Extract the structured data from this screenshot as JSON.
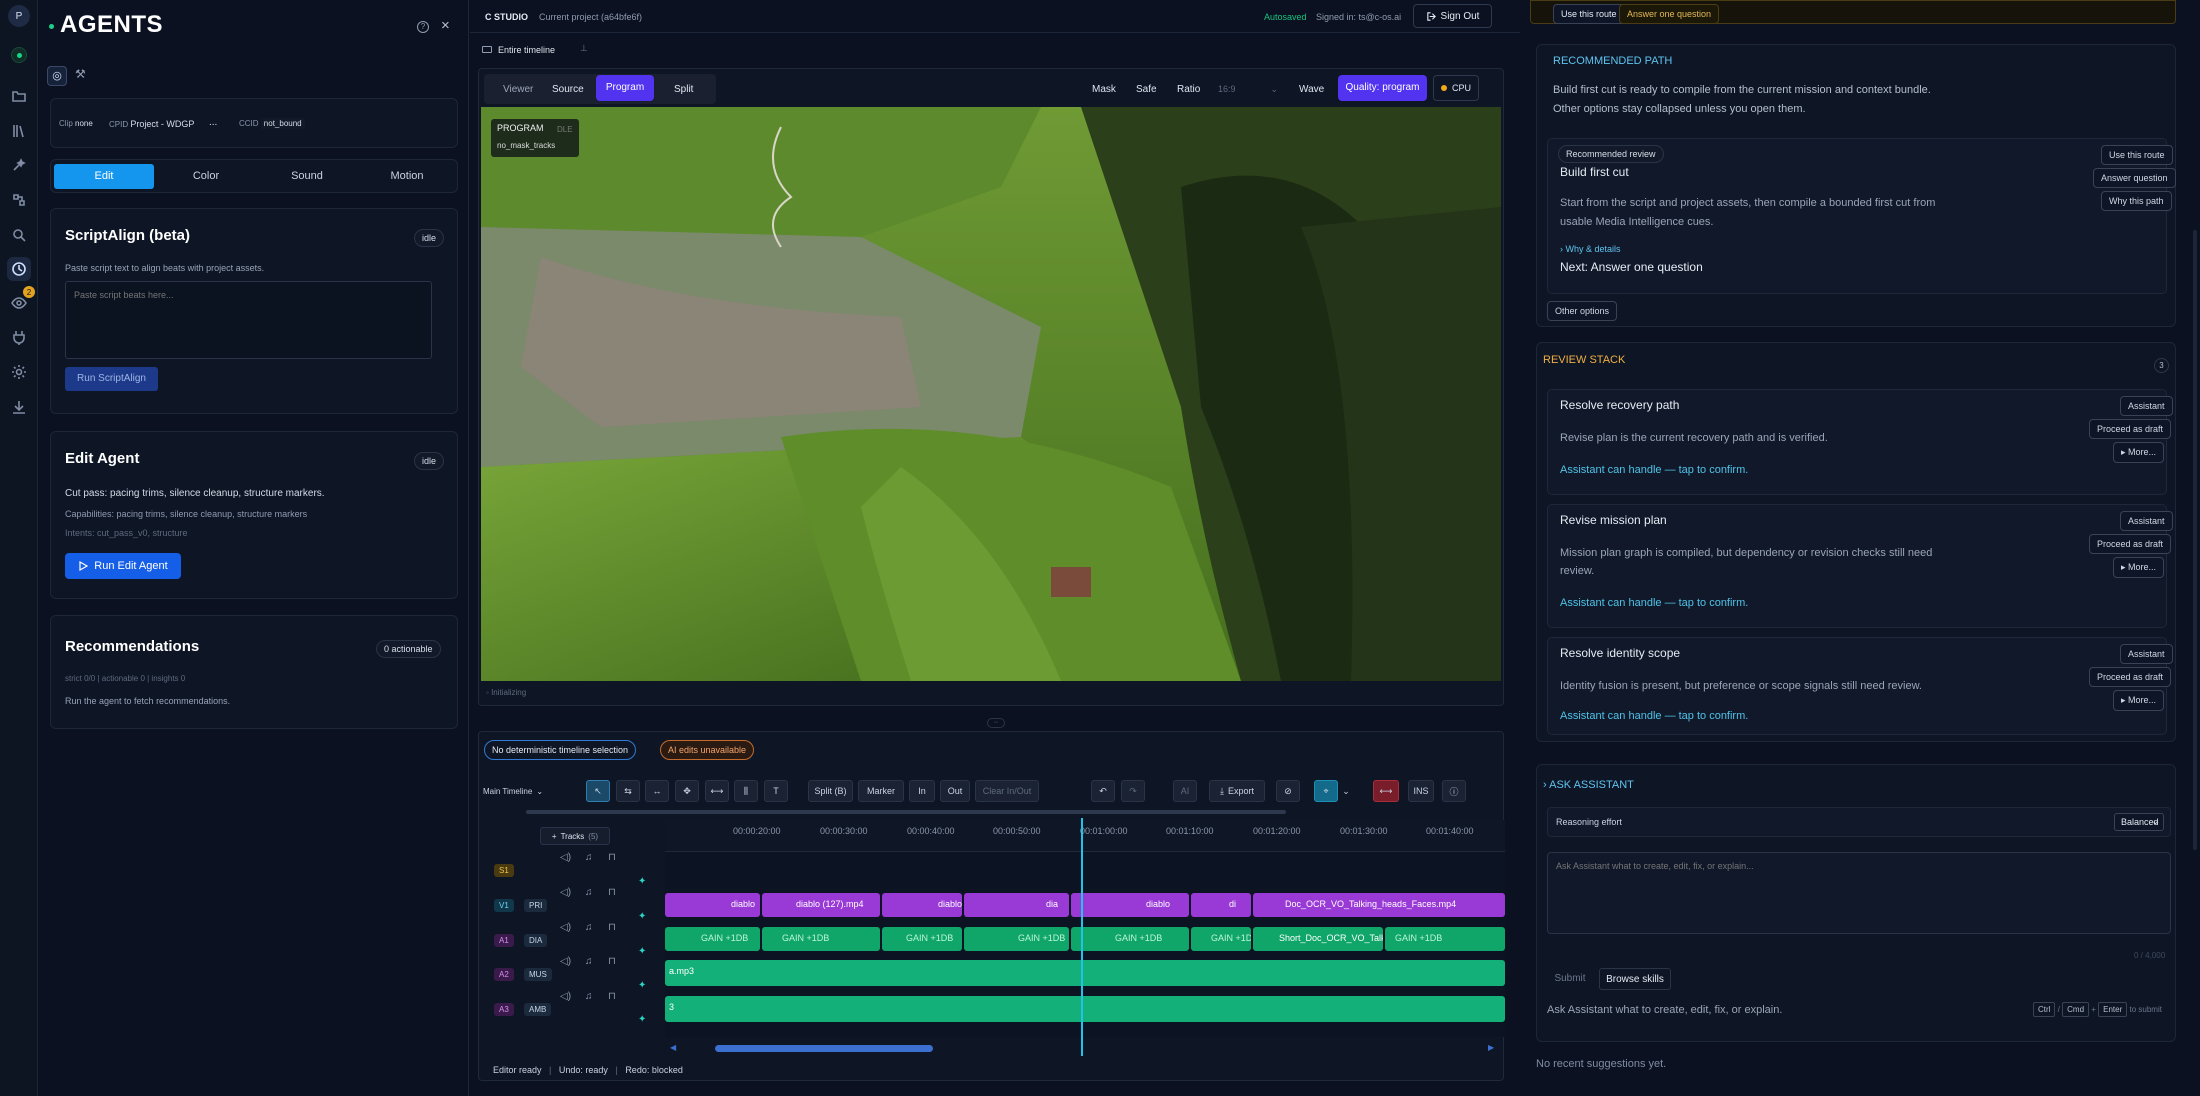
{
  "rail": {
    "avatar": "P",
    "badge": "2"
  },
  "left": {
    "title": "AGENTS",
    "clip": {
      "clip_label": "Clip",
      "clip_value": "none",
      "cpid_label": "CPID",
      "cpid_value": "Project - WDGP",
      "ellipsis": "...",
      "ccid_label": "CCID",
      "ccid_value": "not_bound"
    },
    "tabs": [
      "Edit",
      "Color",
      "Sound",
      "Motion"
    ],
    "scriptalign": {
      "title": "ScriptAlign (beta)",
      "badge": "idle",
      "desc": "Paste script text to align beats with project assets.",
      "placeholder": "Paste script beats here...",
      "button": "Run ScriptAlign"
    },
    "edit_agent": {
      "title": "Edit Agent",
      "badge": "idle",
      "line1": "Cut pass: pacing trims, silence cleanup, structure markers.",
      "line2": "Capabilities: pacing trims, silence cleanup, structure markers",
      "line3": "Intents: cut_pass_v0, structure",
      "button": "Run Edit Agent"
    },
    "recommendations": {
      "title": "Recommendations",
      "badge": "0 actionable",
      "stats": "strict 0/0 | actionable 0 | insights 0",
      "note": "Run the agent to fetch recommendations."
    }
  },
  "center": {
    "app": "C STUDIO",
    "project": "Current project (a64bfe6f)",
    "autosaved": "Autosaved",
    "signed_in": "Signed in: ts@c-os.ai",
    "sign_out": "Sign Out",
    "scope": "Entire timeline",
    "viewer_tabs": [
      "Viewer",
      "Source",
      "Program",
      "Split"
    ],
    "viewer_opts": {
      "mask": "Mask",
      "safe": "Safe",
      "ratio": "Ratio",
      "ratio_value": "16:9",
      "wave": "Wave",
      "quality": "Quality: program",
      "cpu": "CPU"
    },
    "overlay": {
      "title": "PROGRAM",
      "sub": "no_mask_tracks",
      "ghost": "DLE"
    },
    "status": "Initializing",
    "selection": "No deterministic timeline selection",
    "ai_status": "AI edits unavailable",
    "toolbar": {
      "timeline": "Main Timeline",
      "split": "Split (B)",
      "marker": "Marker",
      "in": "In",
      "out": "Out",
      "clear": "Clear In/Out",
      "ai": "AI",
      "export": "Export",
      "ins": "INS"
    },
    "tracks_button": "Tracks",
    "tracks_count": "(5)",
    "ruler": [
      "00:00:20:00",
      "00:00:30:00",
      "00:00:40:00",
      "00:00:50:00",
      "00:01:00:00",
      "00:01:10:00",
      "00:01:20:00",
      "00:01:30:00",
      "00:01:40:00"
    ],
    "tracks": [
      {
        "id": "S1",
        "tag": ""
      },
      {
        "id": "V1",
        "tag": "PRI"
      },
      {
        "id": "A1",
        "tag": "DIA"
      },
      {
        "id": "A2",
        "tag": "MUS"
      },
      {
        "id": "A3",
        "tag": "AMB"
      }
    ],
    "clips_v1": [
      "diablo",
      "diablo (127).mp4",
      "diablo",
      "dia",
      "diablo",
      "di",
      "Doc_OCR_VO_Talking_heads_Faces.mp4"
    ],
    "clips_a1": [
      "GAIN +1DB",
      "GAIN +1DB",
      "GAIN +1DB",
      "GAIN +1DB",
      "GAIN +1DB",
      "GAIN +1DB",
      "GAIN +1DB",
      "Short_Doc_OCR_VO_Talking_...",
      "GAIN +1DB"
    ],
    "a2_label": "a.mp3",
    "a3_label": "3",
    "footer": {
      "editor": "Editor ready",
      "undo": "Undo: ready",
      "redo": "Redo: blocked"
    }
  },
  "right": {
    "top": {
      "use_route": "Use this route",
      "answer": "Answer one question"
    },
    "recommended": {
      "heading": "RECOMMENDED PATH",
      "desc1": "Build first cut is ready to compile from the current mission and context bundle.",
      "desc2": "Other options stay collapsed unless you open them.",
      "badge": "Recommended review",
      "title": "Build first cut",
      "body1": "Start from the script and project assets, then compile a bounded first cut from",
      "body2": "usable Media Intelligence cues.",
      "why": "Why & details",
      "next": "Next: Answer one question",
      "btn_use": "Use this route",
      "btn_answer": "Answer question",
      "btn_why": "Why this path",
      "other": "Other options"
    },
    "review": {
      "heading": "REVIEW STACK",
      "count": "3",
      "items": [
        {
          "title": "Resolve recovery path",
          "body": "Revise plan is the current recovery path and is verified.",
          "body2": "",
          "handle": "Assistant can handle — tap to confirm.",
          "tag": "Assistant",
          "draft": "Proceed as draft",
          "more": "More..."
        },
        {
          "title": "Revise mission plan",
          "body": "Mission plan graph is compiled, but dependency or revision checks still need",
          "body2": "review.",
          "handle": "Assistant can handle — tap to confirm.",
          "tag": "Assistant",
          "draft": "Proceed as draft",
          "more": "More..."
        },
        {
          "title": "Resolve identity scope",
          "body": "Identity fusion is present, but preference or scope signals still need review.",
          "body2": "",
          "handle": "Assistant can handle — tap to confirm.",
          "tag": "Assistant",
          "draft": "Proceed as draft",
          "more": "More..."
        }
      ]
    },
    "assistant": {
      "heading": "ASK ASSISTANT",
      "reasoning": "Reasoning effort",
      "effort": "Balanced",
      "placeholder": "Ask Assistant what to create, edit, fix, or explain...",
      "counter": "0 / 4,000",
      "submit": "Submit",
      "browse": "Browse skills",
      "hint": "Ask Assistant what to create, edit, fix, or explain.",
      "k1": "Ctrl",
      "k2": "Cmd",
      "k3": "Enter",
      "to_submit": "to submit"
    },
    "empty": "No recent suggestions yet."
  }
}
